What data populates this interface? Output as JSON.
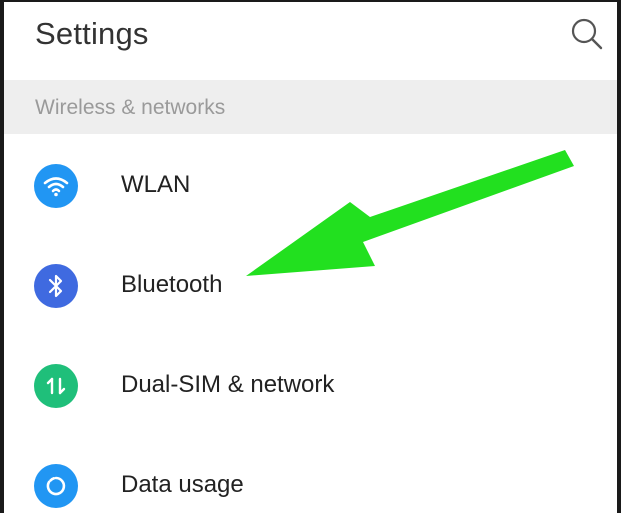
{
  "header": {
    "title": "Settings",
    "search_icon": "search-icon"
  },
  "section": {
    "label": "Wireless & networks"
  },
  "items": [
    {
      "label": "WLAN",
      "icon": "wifi-icon",
      "color": "#2196f3"
    },
    {
      "label": "Bluetooth",
      "icon": "bluetooth-icon",
      "color": "#3f6ae0"
    },
    {
      "label": "Dual-SIM & network",
      "icon": "dual-sim-icon",
      "color": "#1fbf7a"
    },
    {
      "label": "Data usage",
      "icon": "data-usage-icon",
      "color": "#2196f3"
    }
  ],
  "annotation": {
    "arrow_color": "#22e01f",
    "points_to": "Bluetooth"
  }
}
